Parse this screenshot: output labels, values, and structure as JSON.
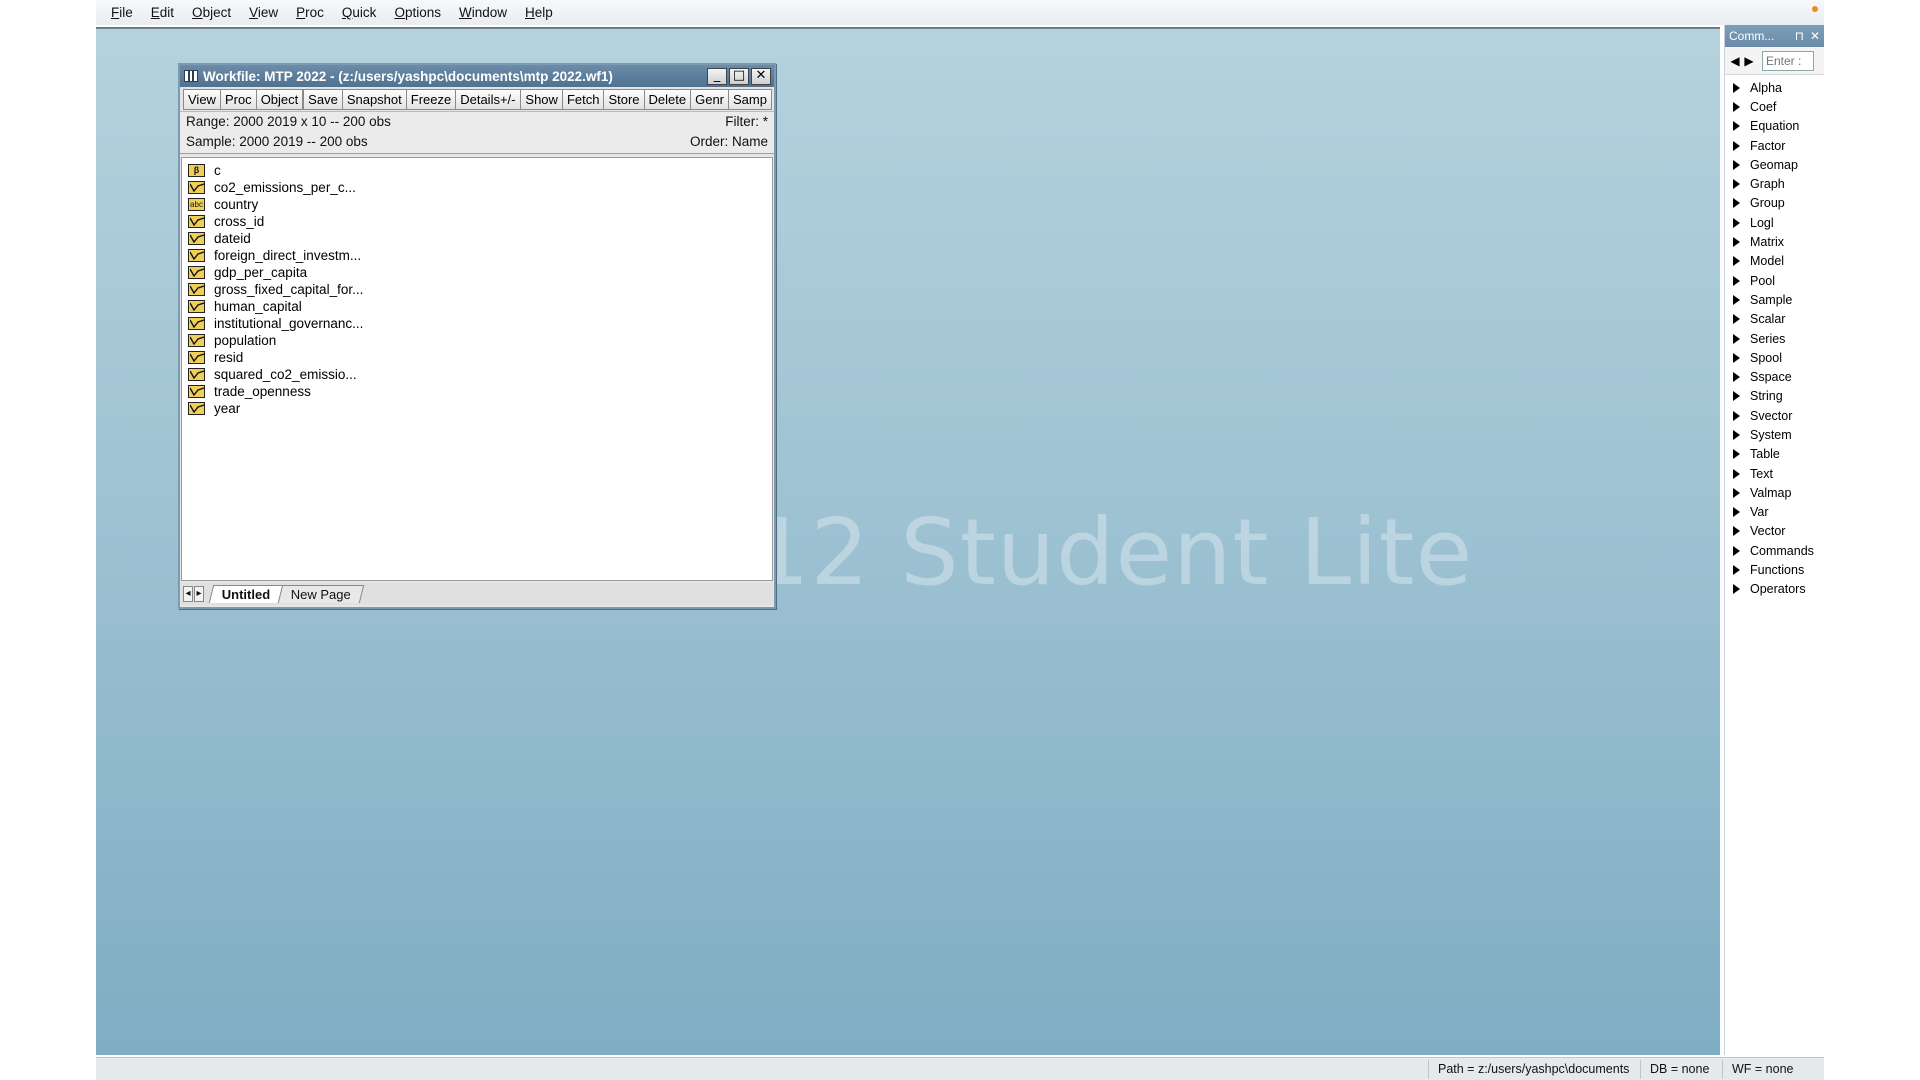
{
  "menu": [
    "File",
    "Edit",
    "Object",
    "View",
    "Proc",
    "Quick",
    "Options",
    "Window",
    "Help"
  ],
  "watermark": "12 Student Lite",
  "workfile": {
    "title": "Workfile: MTP 2022 - (z:/users/yashpc\\documents\\mtp 2022.wf1)",
    "buttons": {
      "minimize": "_",
      "maximize": "□",
      "close": "✕"
    },
    "toolbar_group1": [
      "View",
      "Proc",
      "Object"
    ],
    "toolbar_group2": [
      "Save",
      "Snapshot",
      "Freeze",
      "Details+/-"
    ],
    "toolbar_group3": [
      "Show",
      "Fetch",
      "Store",
      "Delete",
      "Genr",
      "Samp"
    ],
    "range": "Range:  2000 2019 x 10   --   200 obs",
    "filter": "Filter: *",
    "sample": "Sample: 2000 2019   --   200 obs",
    "order": "Order: Name",
    "objects": [
      {
        "name": "c",
        "type": "coef",
        "icon": "β"
      },
      {
        "name": "co2_emissions_per_c...",
        "type": "series"
      },
      {
        "name": "country",
        "type": "alpha",
        "icon": "abc"
      },
      {
        "name": "cross_id",
        "type": "series"
      },
      {
        "name": "dateid",
        "type": "series"
      },
      {
        "name": "foreign_direct_investm...",
        "type": "series"
      },
      {
        "name": "gdp_per_capita",
        "type": "series"
      },
      {
        "name": "gross_fixed_capital_for...",
        "type": "series"
      },
      {
        "name": "human_capital",
        "type": "series"
      },
      {
        "name": "institutional_governanc...",
        "type": "series"
      },
      {
        "name": "population",
        "type": "series"
      },
      {
        "name": "resid",
        "type": "series"
      },
      {
        "name": "squared_co2_emissio...",
        "type": "series"
      },
      {
        "name": "trade_openness",
        "type": "series"
      },
      {
        "name": "year",
        "type": "series"
      }
    ],
    "tabs": [
      "Untitled",
      "New Page"
    ],
    "tab_arrows": [
      "◂",
      "▸"
    ]
  },
  "command_panel": {
    "title": "Comm...",
    "pin": "⊓",
    "close": "✕",
    "nav_back": "◀",
    "nav_forward": "▶",
    "input_placeholder": "Enter :",
    "items": [
      "Alpha",
      "Coef",
      "Equation",
      "Factor",
      "Geomap",
      "Graph",
      "Group",
      "Logl",
      "Matrix",
      "Model",
      "Pool",
      "Sample",
      "Scalar",
      "Series",
      "Spool",
      "Sspace",
      "String",
      "Svector",
      "System",
      "Table",
      "Text",
      "Valmap",
      "Var",
      "Vector",
      "Commands",
      "Functions",
      "Operators"
    ]
  },
  "status": {
    "path": "Path = z:/users/yashpc\\documents",
    "db": "DB = none",
    "wf": "WF = none"
  },
  "colors": {
    "desktop_top": "#b5d2dd",
    "desktop_bottom": "#7fadc3",
    "titlebar": "#5a7c9a",
    "object_icon": "#f0cf58"
  }
}
